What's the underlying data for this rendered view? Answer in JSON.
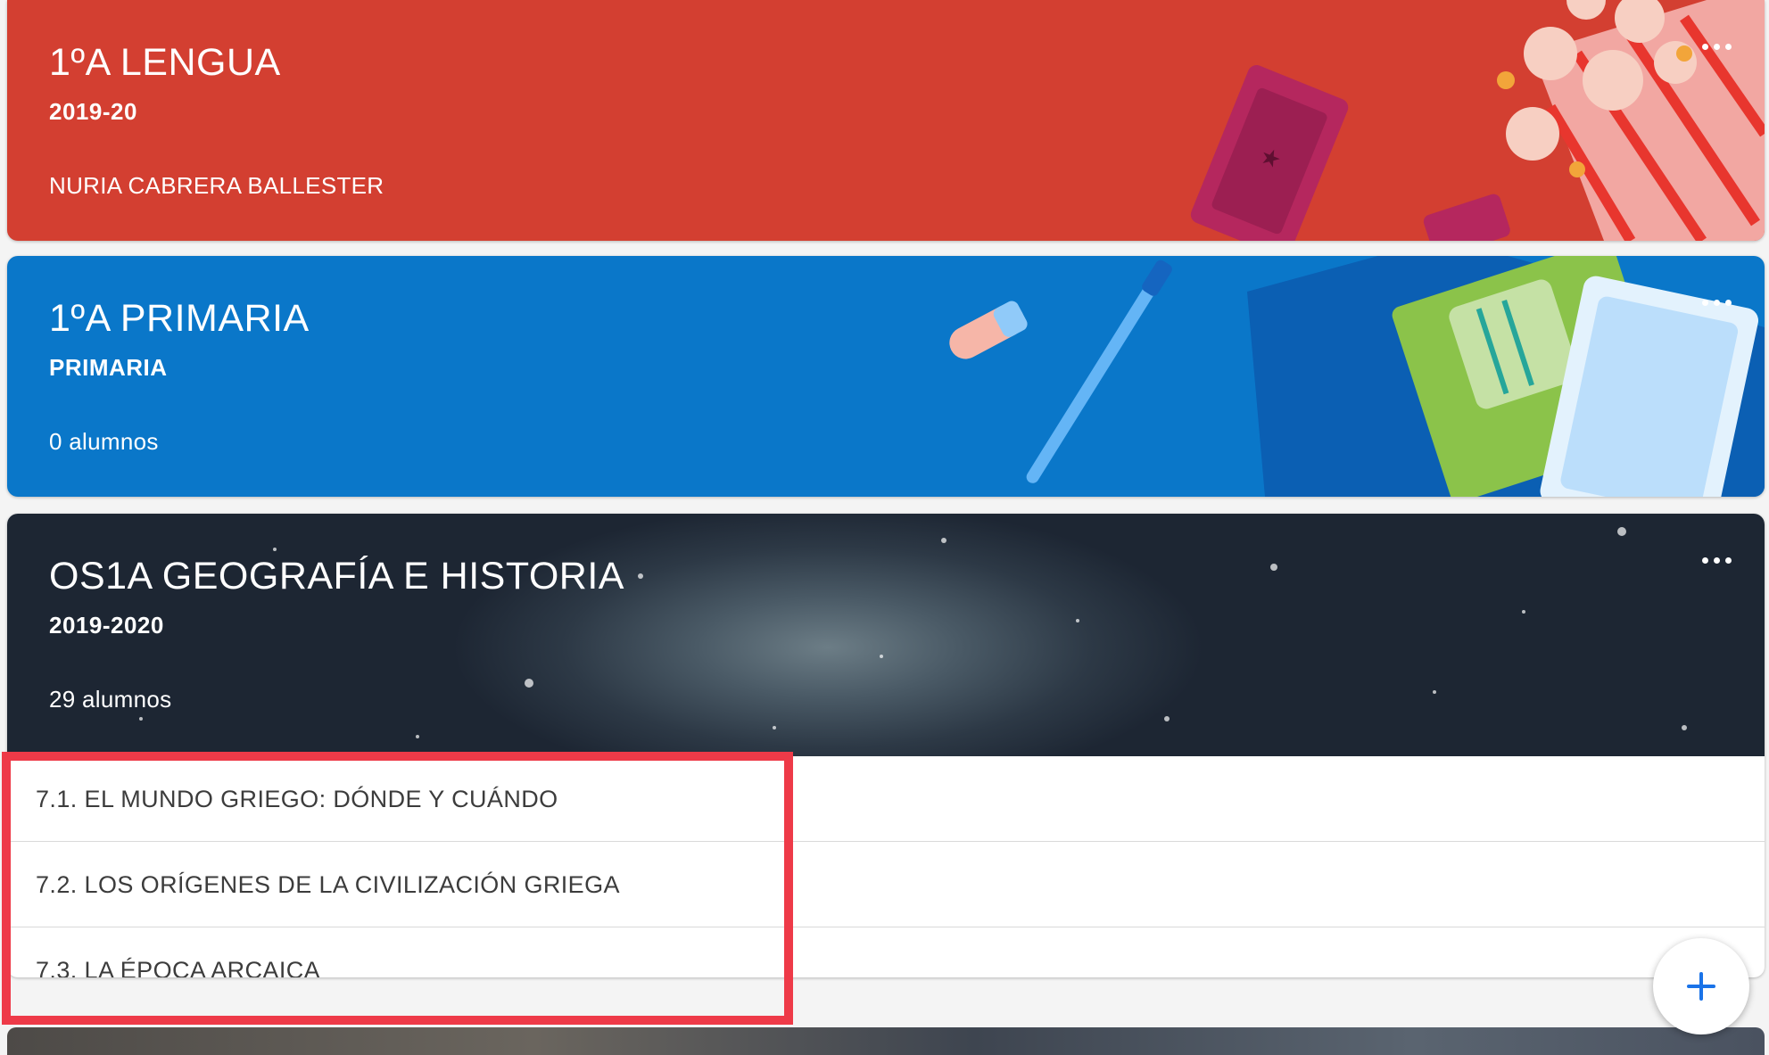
{
  "classes": [
    {
      "title": "1ºA LENGUA",
      "section": "2019-20",
      "meta": "NURIA CABRERA BALLESTER",
      "theme_color": "#d33f31",
      "menu_icon": "more-horizontal-icon"
    },
    {
      "title": "1ºA PRIMARIA",
      "section": "PRIMARIA",
      "meta": "0 alumnos",
      "theme_color": "#0a77c9",
      "menu_icon": "more-horizontal-icon"
    },
    {
      "title": "OS1A GEOGRAFÍA E HISTORIA",
      "section": "2019-2020",
      "meta": "29 alumnos",
      "theme_color": "#2d3946",
      "menu_icon": "more-horizontal-icon",
      "topics": [
        "7.1. EL MUNDO GRIEGO: DÓNDE Y CUÁNDO",
        "7.2. LOS ORÍGENES DE LA CIVILIZACIÓN GRIEGA",
        "7.3. LA ÉPOCA ARCAICA"
      ]
    }
  ],
  "fab": {
    "icon": "plus-icon",
    "color": "#1a73e8"
  },
  "highlight_color": "#ee3a48"
}
